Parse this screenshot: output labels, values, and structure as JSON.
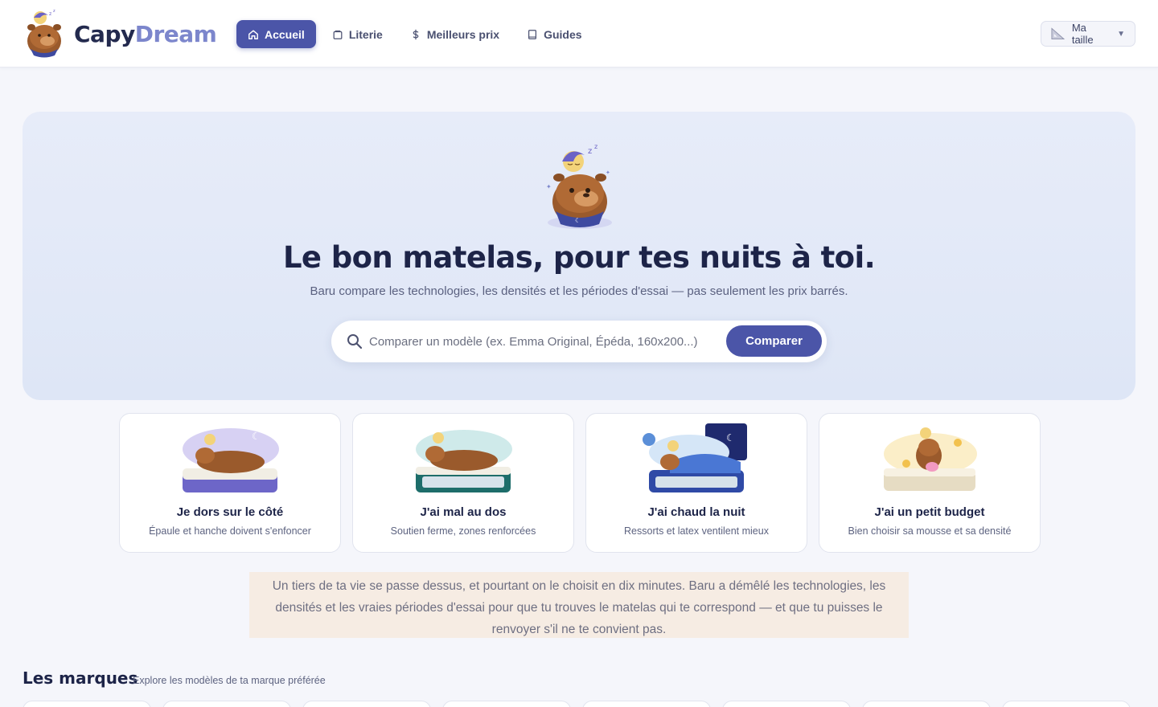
{
  "brand": {
    "name_part1": "Capy",
    "name_part2": "Dream"
  },
  "nav": {
    "items": [
      {
        "label": "Accueil",
        "icon": "home-icon",
        "active": true
      },
      {
        "label": "Literie",
        "icon": "bag-icon",
        "active": false
      },
      {
        "label": "Meilleurs prix",
        "icon": "dollar-icon",
        "active": false
      },
      {
        "label": "Guides",
        "icon": "book-icon",
        "active": false
      }
    ]
  },
  "size_selector": {
    "label": "Ma taille",
    "icon": "ruler-triangle-icon"
  },
  "hero": {
    "title": "Le bon matelas, pour tes nuits à toi.",
    "subtitle": "Baru compare les technologies, les densités et les périodes d'essai — pas seulement les prix barrés.",
    "search_placeholder": "Comparer un modèle (ex. Emma Original, Épéda, 160x200...)",
    "search_button": "Comparer"
  },
  "profiles": [
    {
      "title": "Je dors sur le côté",
      "desc": "Épaule et hanche doivent s'enfoncer"
    },
    {
      "title": "J'ai mal au dos",
      "desc": "Soutien ferme, zones renforcées"
    },
    {
      "title": "J'ai chaud la nuit",
      "desc": "Ressorts et latex ventilent mieux"
    },
    {
      "title": "J'ai un petit budget",
      "desc": "Bien choisir sa mousse et sa densité"
    }
  ],
  "intro_text": "Un tiers de ta vie se passe dessus, et pourtant on le choisit en dix minutes. Baru a démêlé les technologies, les densités et les vraies périodes d'essai pour que tu trouves le matelas qui te correspond — et que tu puisses le renvoyer s'il ne te convient pas.",
  "brands_section": {
    "title": "Les marques",
    "subtitle": "Explore les modèles de ta marque préférée"
  },
  "colors": {
    "accent": "#4b55a8",
    "brand_light": "#7c86cc",
    "hero_bg": "#e3e9f8",
    "intro_bg": "#f6ece3"
  }
}
